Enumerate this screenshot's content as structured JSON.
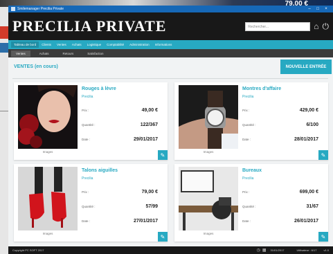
{
  "background": {
    "price": "79,00 €"
  },
  "window": {
    "title": "Smilemanager Precilia Private"
  },
  "header": {
    "brand": "PRECILIA PRIVATE",
    "search_placeholder": "Rechercher..."
  },
  "mainnav": [
    "Tableau de bord",
    "Clients",
    "Ventes",
    "Achats",
    "Logistique",
    "Comptabilité",
    "Administration",
    "Informations"
  ],
  "subnav": [
    "Ventes",
    "Achats",
    "Retours",
    "Satisfaction"
  ],
  "section": {
    "title": "VENTES (en cours)",
    "new_button": "NOUVELLE ENTRÉE"
  },
  "labels": {
    "price": "Prix :",
    "quantity": "Quantité :",
    "date": "Date :",
    "images": "Images"
  },
  "products": [
    {
      "name": "Rouges à lèvre",
      "brand": "Precilia",
      "price": "49,00 €",
      "quantity": "122/367",
      "date": "29/01/2017"
    },
    {
      "name": "Montres d'affaire",
      "brand": "Precilia",
      "price": "429,00 €",
      "quantity": "6/100",
      "date": "28/01/2017"
    },
    {
      "name": "Talons aiguilles",
      "brand": "Precilia",
      "price": "79,00 €",
      "quantity": "57/99",
      "date": "27/01/2017"
    },
    {
      "name": "Bureaux",
      "brand": "Precilia",
      "price": "699,00 €",
      "quantity": "31/67",
      "date": "26/01/2017"
    }
  ],
  "footer": {
    "copyright": "Copyright PC SOFT 2017",
    "date": "31/01/2017",
    "user": "Utilisateur : 6/17",
    "version": "v1.0"
  },
  "icons": {
    "home": "home-icon",
    "power": "power-icon",
    "edit": "pencil-icon",
    "clock": "clock-icon",
    "calendar": "calendar-icon"
  },
  "colors": {
    "accent": "#27a9c2",
    "dark": "#181818",
    "titlebar": "#1668b7"
  }
}
